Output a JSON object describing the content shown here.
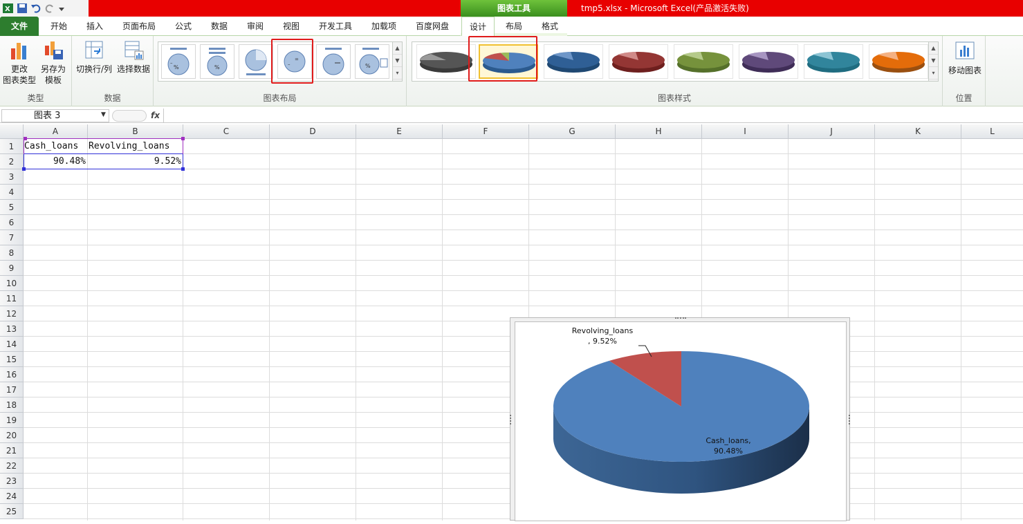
{
  "window": {
    "title": "tmp5.xlsx  -  Microsoft Excel(产品激活失败)",
    "context_header": "图表工具"
  },
  "tabs": [
    "文件",
    "开始",
    "插入",
    "页面布局",
    "公式",
    "数据",
    "审阅",
    "视图",
    "开发工具",
    "加载项",
    "百度网盘",
    "设计",
    "布局",
    "格式"
  ],
  "active_tab": "设计",
  "ribbon": {
    "type_group": {
      "label": "类型",
      "change_type": "更改\n图表类型",
      "save_template": "另存为\n模板"
    },
    "data_group": {
      "label": "数据",
      "switch_row_col": "切换行/列",
      "select_data": "选择数据"
    },
    "layout_group": {
      "label": "图表布局"
    },
    "style_group": {
      "label": "图表样式"
    },
    "location_group": {
      "label": "位置",
      "move_chart": "移动图表"
    }
  },
  "formula_bar": {
    "name_box": "图表 3",
    "fx": "fx",
    "formula": ""
  },
  "columns": [
    "A",
    "B",
    "C",
    "D",
    "E",
    "F",
    "G",
    "H",
    "I",
    "J",
    "K",
    "L"
  ],
  "rows": [
    "1",
    "2",
    "3",
    "4",
    "5",
    "6",
    "7",
    "8",
    "9",
    "10",
    "11",
    "12",
    "13",
    "14",
    "15",
    "16",
    "17",
    "18",
    "19",
    "20",
    "21",
    "22",
    "23",
    "24",
    "25"
  ],
  "cells": {
    "A1": "Cash_loans",
    "B1": "Revolving_loans",
    "A2": "90.48%",
    "B2": "9.52%"
  },
  "colors": {
    "excel_green": "#2d7d2e",
    "title_red": "#e80000",
    "pie_blue": "#4f81bd",
    "pie_red": "#c0504d"
  },
  "chart_data": {
    "type": "pie",
    "categories": [
      "Cash_loans",
      "Revolving_loans"
    ],
    "values": [
      90.48,
      9.52
    ],
    "data_labels": [
      "Cash_loans,\n90.48%",
      "Revolving_loans\n, 9.52%"
    ],
    "title": "",
    "style": "3d"
  }
}
